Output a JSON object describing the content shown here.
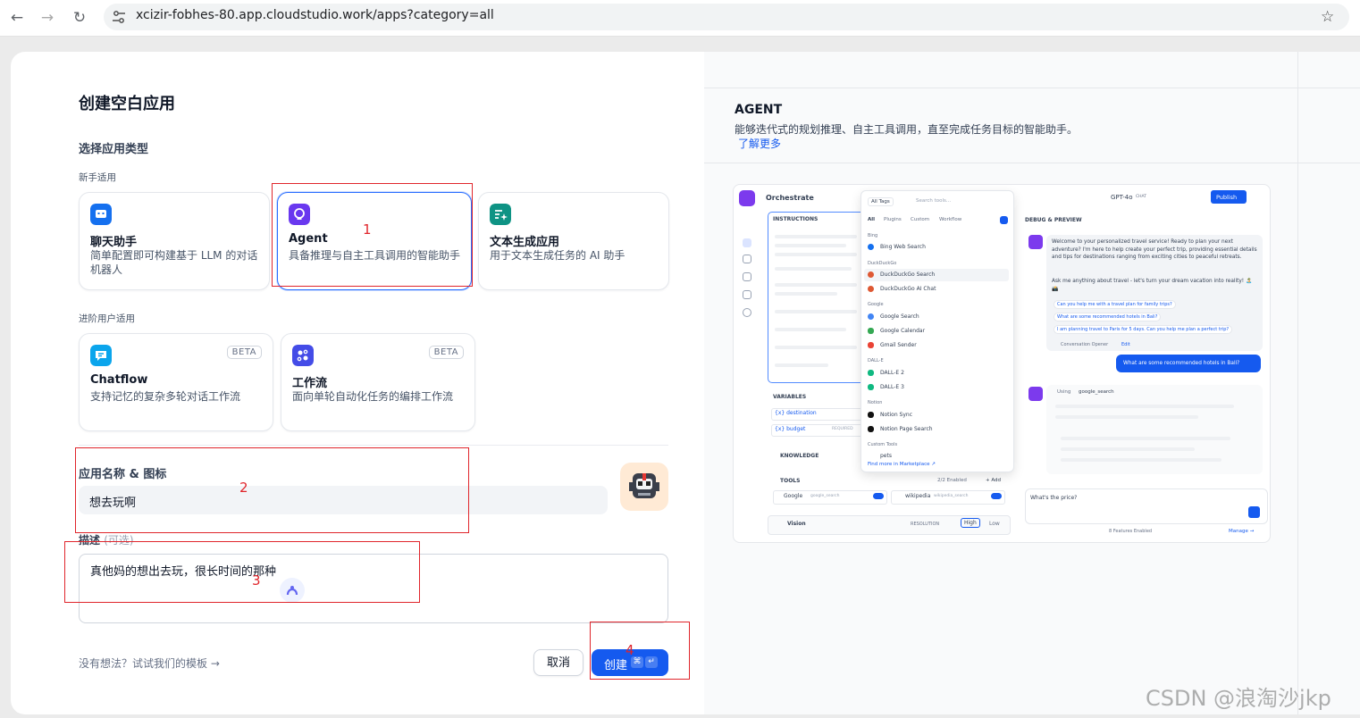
{
  "browser": {
    "url": "xcizir-fobhes-80.app.cloudstudio.work/apps?category=all"
  },
  "dialog": {
    "title": "创建空白应用",
    "select_type_label": "选择应用类型",
    "beginner_label": "新手适用",
    "advanced_label": "进阶用户适用",
    "app_types": [
      {
        "name": "聊天助手",
        "desc": "简单配置即可构建基于 LLM 的对话机器人",
        "color": "#1570ef"
      },
      {
        "name": "Agent",
        "desc": "具备推理与自主工具调用的智能助手",
        "color": "#6938ef"
      },
      {
        "name": "文本生成应用",
        "desc": "用于文本生成任务的 AI 助手",
        "color": "#0e9384"
      },
      {
        "name": "Chatflow",
        "desc": "支持记忆的复杂多轮对话工作流",
        "color": "#0ba5ec",
        "badge": "BETA"
      },
      {
        "name": "工作流",
        "desc": "面向单轮自动化任务的编排工作流",
        "color": "#444ce7",
        "badge": "BETA"
      }
    ],
    "name_icon_label": "应用名称 & 图标",
    "name_value": "想去玩啊",
    "description_label": "描述",
    "description_optional": "(可选)",
    "description_value": "真他妈的想出去玩，很长时间的那种",
    "template_link": "没有想法？试试我们的模板 →",
    "cancel_label": "取消",
    "create_label": "创建",
    "create_kbd_1": "⌘",
    "create_kbd_2": "↵"
  },
  "annotations": [
    "1",
    "2",
    "3",
    "4"
  ],
  "preview": {
    "title": "AGENT",
    "desc": "能够迭代式的规划推理、自主工具调用，直至完成任务目标的智能助手。",
    "learn_more": "了解更多",
    "mock": {
      "orchestrate": "Orchestrate",
      "instructions": "INSTRUCTIONS",
      "variables": "VARIABLES",
      "var1": "{x} destination",
      "var2": "{x} budget",
      "required": "REQUIRED",
      "knowledge": "KNOWLEDGE",
      "tools": "TOOLS",
      "tools_enabled": "2/2 Enabled",
      "add": "+ Add",
      "tool_google": "Google",
      "tool_google_sub": "google_search",
      "tool_wiki": "wikipedia",
      "tool_wiki_sub": "wikipedia_search",
      "vision": "Vision",
      "resolution": "RESOLUTION",
      "high": "High",
      "low": "Low",
      "all_tags": "All Tags",
      "search_tools": "Search tools...",
      "tabs": [
        "All",
        "Plugins",
        "Custom",
        "Workflow"
      ],
      "groups": [
        "Bing",
        "DuckDuckGo",
        "Google",
        "DALL-E",
        "Notion",
        "Custom Tools"
      ],
      "items": [
        "Bing Web Search",
        "DuckDuckGo Search",
        "DuckDuckGo AI Chat",
        "Google Search",
        "Google Calendar",
        "Gmail Sender",
        "DALL-E 2",
        "DALL-E 3",
        "Notion Sync",
        "Notion Page Search",
        "pets"
      ],
      "marketplace": "Find more in Marketplace ↗",
      "model": "GPT-4o",
      "chat_tag": "CHAT",
      "publish": "Publish",
      "debug": "DEBUG & PREVIEW",
      "welcome1": "Welcome to your personalized travel service! Ready to plan your next adventure? I'm here to help create your perfect trip, providing essential details and tips for destinations ranging from exciting cities to peaceful retreats.",
      "welcome2": "Ask me anything about travel - let's turn your dream vacation into reality! 🏝️ 📸",
      "sugg1": "Can you help me with a travel plan for family trips?",
      "sugg2": "What are some recommended hotels in Bali?",
      "sugg3": "I am planning travel to Paris for 5 days. Can you help me plan a perfect trip?",
      "opener": "Conversation Opener",
      "edit": "Edit",
      "user_msg": "What are some recommended hotels in Bali?",
      "using": "Using",
      "using_tool": "google_search",
      "input_ph": "What's the price?",
      "features": "8 Features Enabled",
      "manage": "Manage →"
    }
  },
  "watermark": "CSDN @浪淘沙jkp"
}
